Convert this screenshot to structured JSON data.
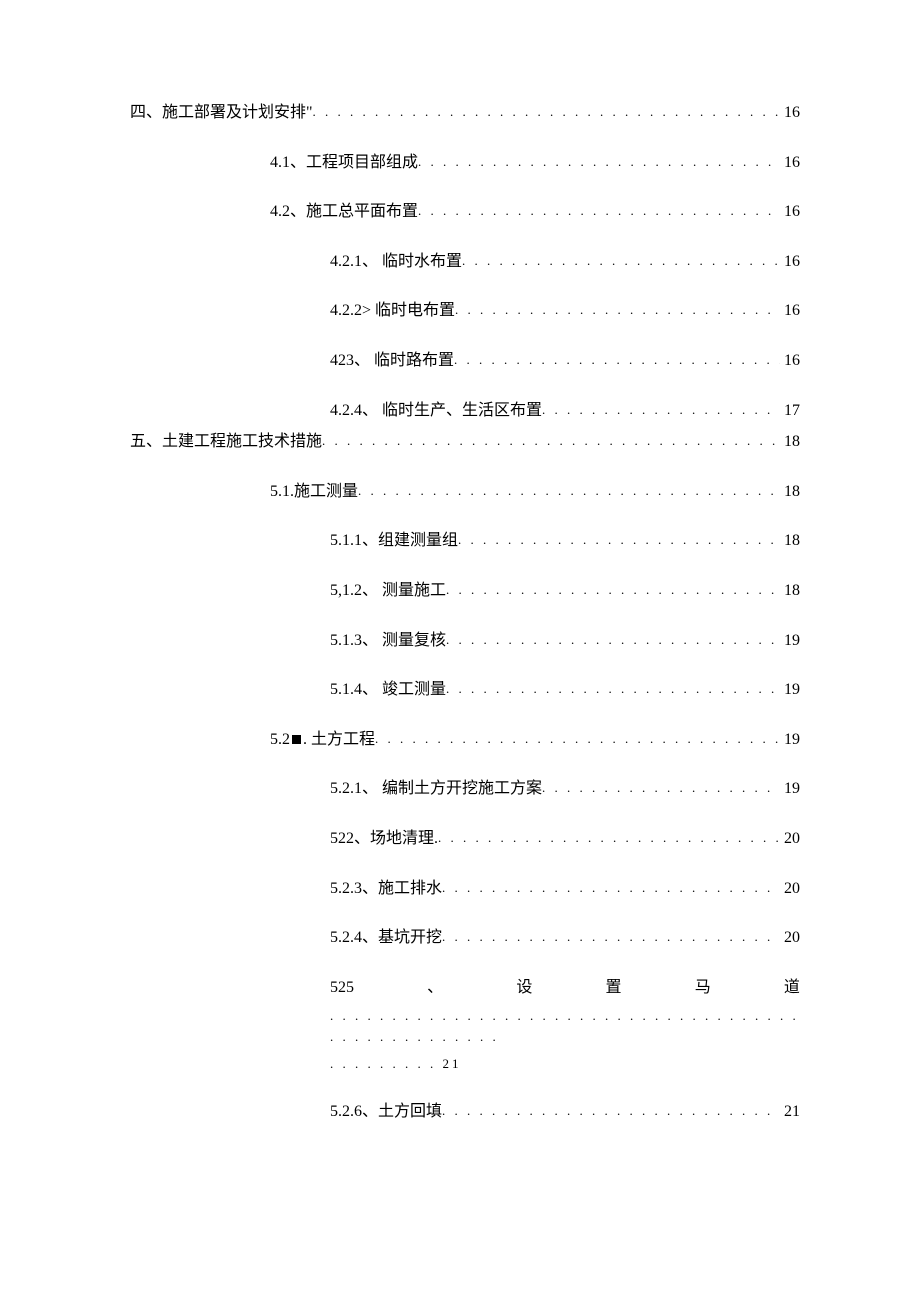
{
  "toc": {
    "item4": {
      "label": "四、施工部署及计划安排\"",
      "page": "16"
    },
    "item4_1": {
      "label": "4.1、工程项目部组成",
      "page": "16"
    },
    "item4_2": {
      "label": "4.2、施工总平面布置",
      "page": "16"
    },
    "item4_2_1": {
      "label": "4.2.1、  临时水布置",
      "page": "16"
    },
    "item4_2_2": {
      "label": "4.2.2>   临时电布置",
      "page": "16"
    },
    "item4_2_3": {
      "label": "423、   临时路布置",
      "page": "16"
    },
    "item4_2_4": {
      "label": "4.2.4、  临时生产、生活区布置",
      "page": "17"
    },
    "item5": {
      "label": "五、土建工程施工技术措施",
      "page": "18"
    },
    "item5_1": {
      "label": "5.1.施工测量",
      "page": "18"
    },
    "item5_1_1": {
      "label": "5.1.1、组建测量组",
      "page": "18"
    },
    "item5_1_2": {
      "label": "5,1.2、  测量施工",
      "page": "18"
    },
    "item5_1_3": {
      "label": "5.1.3、  测量复核",
      "page": "19"
    },
    "item5_1_4": {
      "label": "5.1.4、  竣工测量",
      "page": "19"
    },
    "item5_2_pre": "5.2",
    "item5_2_post": ".  土方工程",
    "item5_2_page": "19",
    "item5_2_1": {
      "label": "5.2.1、  编制土方开挖施工方案",
      "page": "19"
    },
    "item5_2_2": {
      "label": "522、场地清理.",
      "page": "20"
    },
    "item5_2_3": {
      "label": "5.2.3、施工排水",
      "page": "20"
    },
    "item5_2_4": {
      "label": "5.2.4、基坑开挖",
      "page": "20"
    },
    "item5_2_5_c1": "525",
    "item5_2_5_c2": "、",
    "item5_2_5_c3": "设",
    "item5_2_5_c4": "置",
    "item5_2_5_c5": "马",
    "item5_2_5_c6": "道",
    "item5_2_5_dots": ". . . . . . . . . . . . . . . . . . . . . . . . . . . . . . . . . . . . . . . . . . . . . . . . . . . .",
    "item5_2_5_end": ". . . . . . . . . 21",
    "item5_2_6": {
      "label": "5.2.6、土方回填",
      "page": "21"
    }
  }
}
